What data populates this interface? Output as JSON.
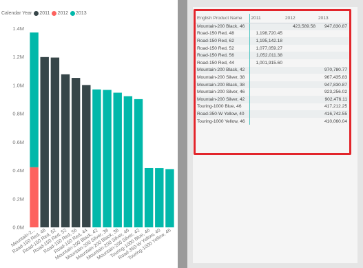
{
  "legend": {
    "title": "Calendar Year",
    "items": [
      {
        "label": "2011",
        "color": "#374649"
      },
      {
        "label": "2012",
        "color": "#fd625e"
      },
      {
        "label": "2013",
        "color": "#01b8aa"
      }
    ]
  },
  "chart_data": {
    "type": "bar",
    "stacked": true,
    "y_ticks": [
      "0.0M",
      "0.2M",
      "0.4M",
      "0.6M",
      "0.8M",
      "1.0M",
      "1.2M",
      "1.4M"
    ],
    "ylim": [
      0,
      1.45
    ],
    "categories": [
      "Mountain-2...",
      "Road-150 Red, 48",
      "Road-150 Red, 62",
      "Road-150 Red, 52",
      "Road-150 Red, 56",
      "Road-150 Red, 44",
      "Mountain-200 Black, 42",
      "Mountain-200 Silver, 38",
      "Mountain-200 Black, 38",
      "Mountain-200 Silver, 46",
      "Mountain-200 Silver, 42",
      "Touring-1000 Blue, 46",
      "Road-350-W Yellow, 40",
      "Touring-1000 Yellow, 46"
    ],
    "series": [
      {
        "name": "2011",
        "color": "#374649",
        "values": [
          0,
          1.19872,
          1.195142,
          1.077059,
          1.052011,
          1.001916,
          0,
          0,
          0,
          0,
          0,
          0,
          0,
          0
        ]
      },
      {
        "name": "2012",
        "color": "#fd625e",
        "values": [
          0.42359,
          0,
          0,
          0,
          0,
          0,
          0,
          0,
          0,
          0,
          0,
          0,
          0,
          0
        ]
      },
      {
        "name": "2013",
        "color": "#01b8aa",
        "values": [
          0.947831,
          0,
          0,
          0,
          0,
          0,
          0.970781,
          0.967436,
          0.947831,
          0.923256,
          0.902476,
          0.417212,
          0.416743,
          0.41006
        ]
      }
    ]
  },
  "table": {
    "headers": [
      "English Product Name",
      "2011",
      "2012",
      "2013"
    ],
    "rows": [
      [
        "Mountain-200 Black, 46",
        "",
        "423,589.58",
        "947,830.87"
      ],
      [
        "Road-150 Red, 48",
        "1,198,720.45",
        "",
        ""
      ],
      [
        "Road-150 Red, 62",
        "1,195,142.18",
        "",
        ""
      ],
      [
        "Road-150 Red, 52",
        "1,077,059.27",
        "",
        ""
      ],
      [
        "Road-150 Red, 56",
        "1,052,011.38",
        "",
        ""
      ],
      [
        "Road-150 Red, 44",
        "1,001,915.60",
        "",
        ""
      ],
      [
        "Mountain-200 Black, 42",
        "",
        "",
        "970,780.77"
      ],
      [
        "Mountain-200 Silver, 38",
        "",
        "",
        "967,435.83"
      ],
      [
        "Mountain-200 Black, 38",
        "",
        "",
        "947,830.87"
      ],
      [
        "Mountain-200 Silver, 46",
        "",
        "",
        "923,256.02"
      ],
      [
        "Mountain-200 Silver, 42",
        "",
        "",
        "902,476.11"
      ],
      [
        "Touring-1000 Blue, 46",
        "",
        "",
        "417,212.25"
      ],
      [
        "Road-350-W Yellow, 40",
        "",
        "",
        "416,742.55"
      ],
      [
        "Touring-1000 Yellow, 46",
        "",
        "",
        "410,060.04"
      ]
    ]
  }
}
